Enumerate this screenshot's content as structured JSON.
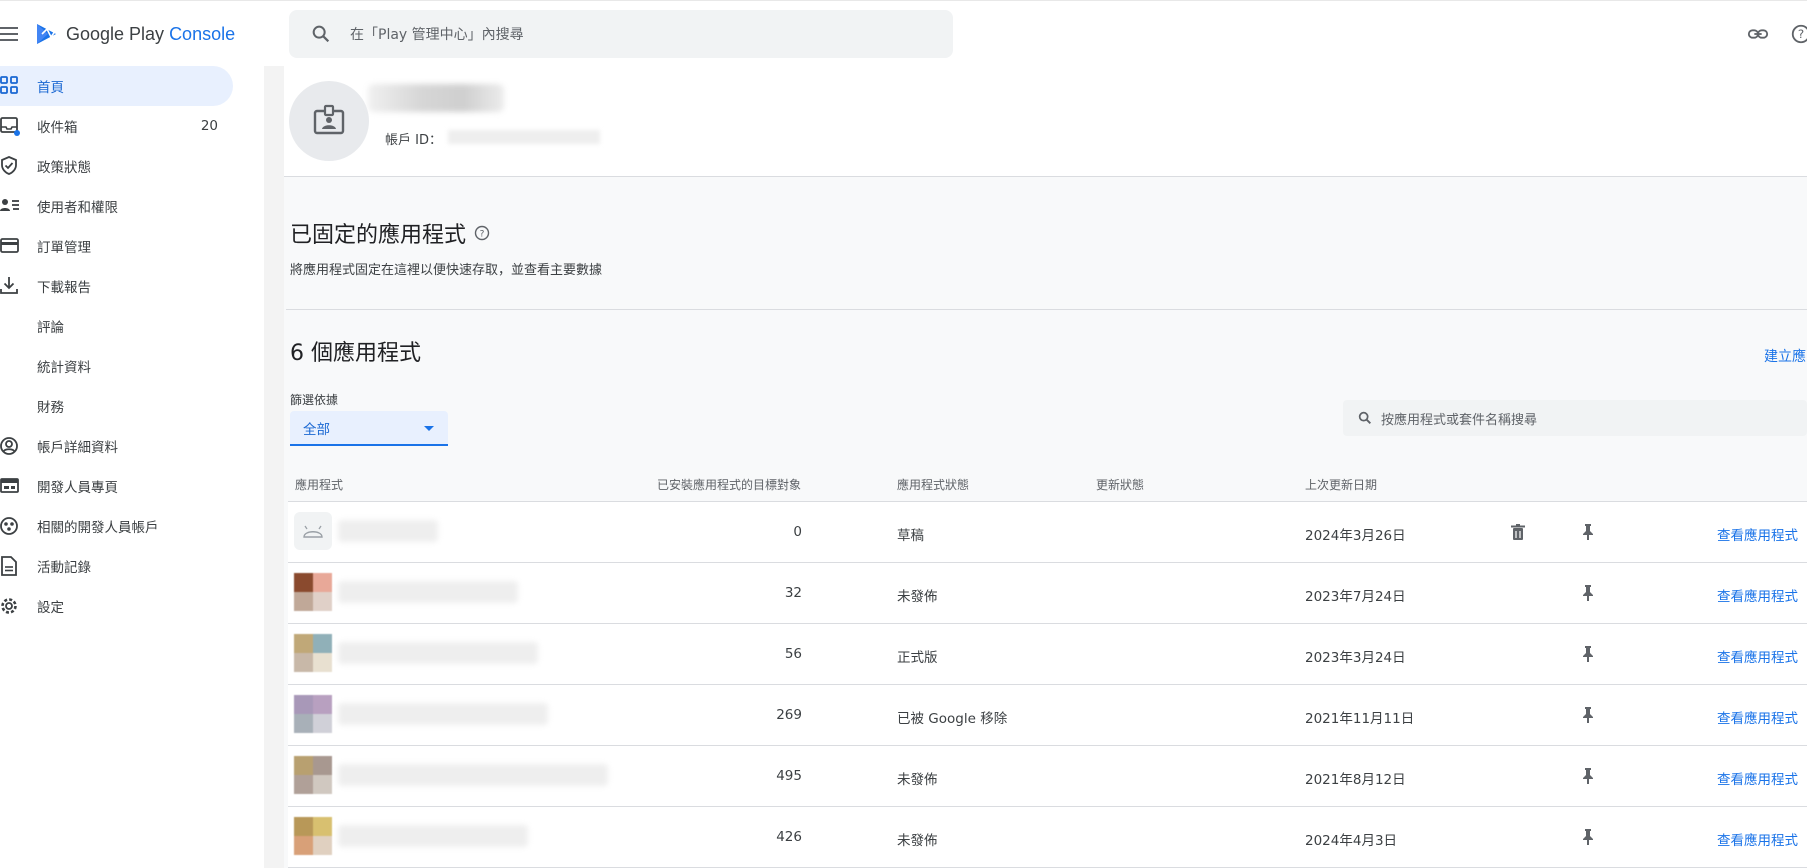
{
  "header": {
    "logo_text": "Google Play",
    "logo_accent": "Console",
    "search_placeholder": "在「Play 管理中心」內搜尋",
    "icons": [
      "menu-icon",
      "search-icon",
      "link-icon",
      "help-icon"
    ]
  },
  "sidebar": {
    "items": [
      {
        "label": "首頁",
        "icon": "home-grid-icon",
        "active": true
      },
      {
        "label": "收件箱",
        "icon": "inbox-icon",
        "count": "20"
      },
      {
        "label": "政策狀態",
        "icon": "shield-icon"
      },
      {
        "label": "使用者和權限",
        "icon": "users-icon"
      },
      {
        "label": "訂單管理",
        "icon": "credit-card-icon"
      },
      {
        "label": "下載報告",
        "icon": "download-icon"
      },
      {
        "label": "評論",
        "icon": ""
      },
      {
        "label": "統計資料",
        "icon": ""
      },
      {
        "label": "財務",
        "icon": ""
      },
      {
        "label": "帳戶詳細資料",
        "icon": "account-circle-icon"
      },
      {
        "label": "開發人員專頁",
        "icon": "developer-page-icon"
      },
      {
        "label": "相關的開發人員帳戶",
        "icon": "linked-accounts-icon"
      },
      {
        "label": "活動記錄",
        "icon": "activity-log-icon"
      },
      {
        "label": "設定",
        "icon": "settings-icon"
      }
    ]
  },
  "account": {
    "id_label": "帳戶 ID："
  },
  "pinned": {
    "title": "已固定的應用程式",
    "subtitle": "將應用程式固定在這裡以便快速存取，並查看主要數據"
  },
  "apps": {
    "title": "6 個應用程式",
    "create_link": "建立應",
    "filter_label": "篩選依據",
    "filter_value": "全部",
    "search_placeholder": "按應用程式或套件名稱搜尋",
    "columns": [
      "應用程式",
      "已安裝應用程式的目標對象",
      "應用程式狀態",
      "更新狀態",
      "上次更新日期"
    ],
    "view_label": "查看應用程式",
    "rows": [
      {
        "installs": "0",
        "status": "草稿",
        "updated": "2024年3月26日",
        "delete": true,
        "icon_colors": []
      },
      {
        "installs": "32",
        "status": "未發佈",
        "updated": "2023年7月24日",
        "delete": false,
        "icon_colors": [
          "#8a4a2e",
          "#e8a898",
          "#c0a898",
          "#e0d0c8"
        ]
      },
      {
        "installs": "56",
        "status": "正式版",
        "updated": "2023年3月24日",
        "delete": false,
        "icon_colors": [
          "#c0a878",
          "#90b0b8",
          "#c8b8a8",
          "#e8e0d0"
        ]
      },
      {
        "installs": "269",
        "status": "已被 Google 移除",
        "updated": "2021年11月11日",
        "delete": false,
        "icon_colors": [
          "#a898b8",
          "#b8a0c0",
          "#a8b0b8",
          "#d0d0d8"
        ]
      },
      {
        "installs": "495",
        "status": "未發佈",
        "updated": "2021年8月12日",
        "delete": false,
        "icon_colors": [
          "#b8a070",
          "#a89890",
          "#b0a098",
          "#d0c8c0"
        ]
      },
      {
        "installs": "426",
        "status": "未發佈",
        "updated": "2024年4月3日",
        "delete": false,
        "icon_colors": [
          "#b89858",
          "#d8c070",
          "#d8a078",
          "#e0d0c0"
        ]
      }
    ]
  },
  "colors": {
    "accent": "#1a73e8",
    "active_bg": "#e8f0fe"
  }
}
